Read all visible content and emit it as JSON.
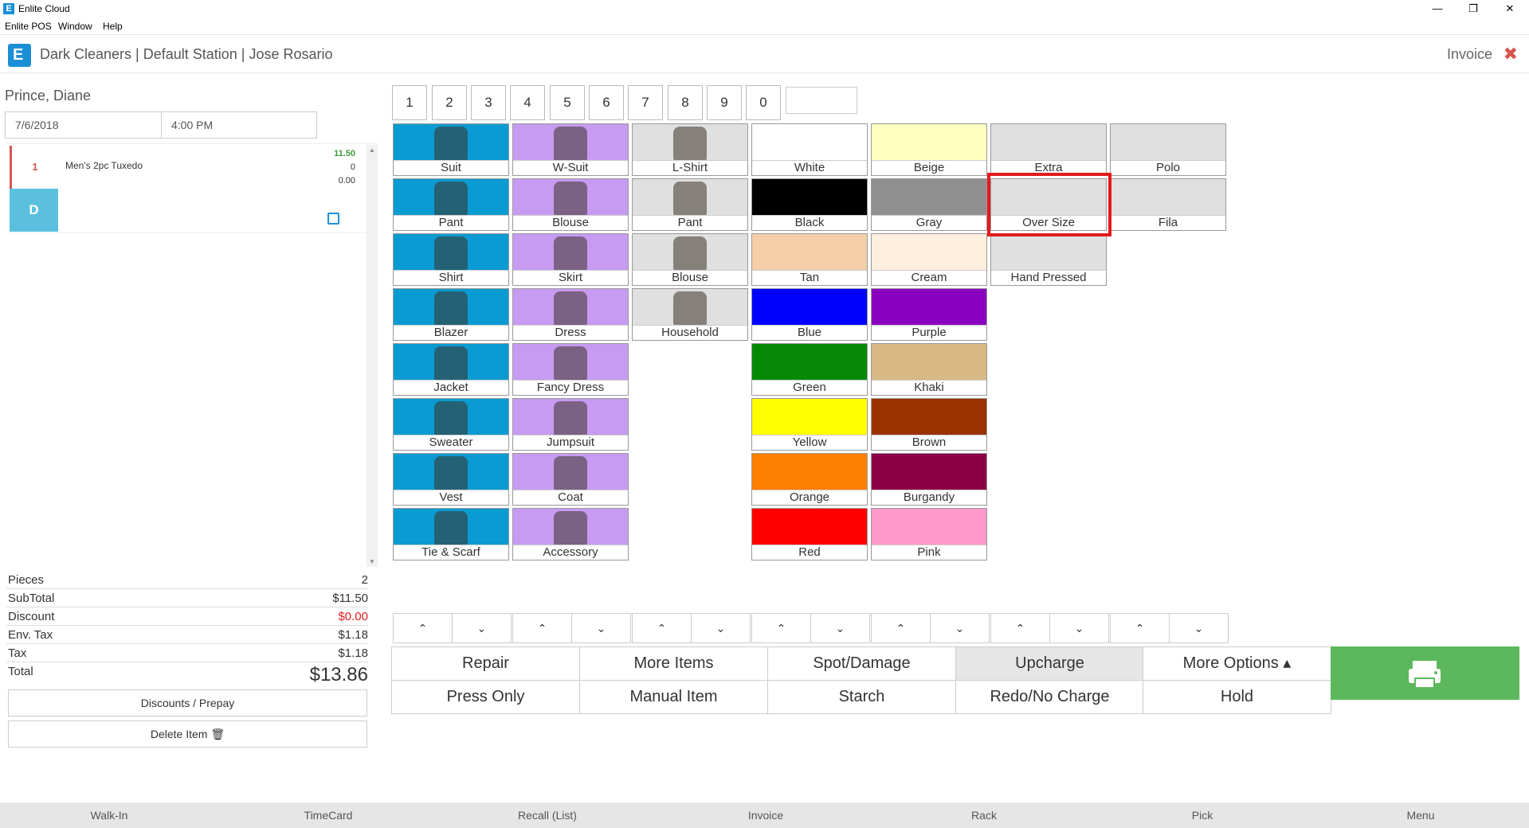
{
  "window": {
    "title": "Enlite Cloud",
    "app_icon": "E",
    "minimize": "—",
    "restore": "❐",
    "close": "✕"
  },
  "menu": [
    "Enlite POS",
    "Window",
    "Help"
  ],
  "header": {
    "store_line": "Dark Cleaners | Default Station | Jose Rosario",
    "section": "Invoice",
    "close_glyph": "✖",
    "logo_letter": "E"
  },
  "customer": {
    "name": "Prince, Diane",
    "date": "7/6/2018",
    "time": "4:00 PM"
  },
  "ticket_items": [
    {
      "qty": "1",
      "name": "Men's 2pc Tuxedo",
      "price": "11.50",
      "v2": "0",
      "v3": "0.00",
      "badge": "D"
    }
  ],
  "totals": {
    "pieces_label": "Pieces",
    "pieces": "2",
    "subtotal_label": "SubTotal",
    "subtotal": "$11.50",
    "discount_label": "Discount",
    "discount": "$0.00",
    "envtax_label": "Env. Tax",
    "envtax": "$1.18",
    "tax_label": "Tax",
    "tax": "$1.18",
    "total_label": "Total",
    "total": "$13.86"
  },
  "left_buttons": {
    "discounts": "Discounts / Prepay",
    "delete": "Delete Item 🗑"
  },
  "numpad": [
    "1",
    "2",
    "3",
    "4",
    "5",
    "6",
    "7",
    "8",
    "9",
    "0"
  ],
  "colors": {
    "male": "#0a9bd2",
    "female": "#c79bf2",
    "other": "#e0e0e0",
    "accent_green": "#5cb85c",
    "highlight": "#e21b1b"
  },
  "categories_male": [
    "Suit",
    "Pant",
    "Shirt",
    "Blazer",
    "Jacket",
    "Sweater",
    "Vest",
    "Tie & Scarf"
  ],
  "categories_female": [
    "W-Suit",
    "Blouse",
    "Skirt",
    "Dress",
    "Fancy Dress",
    "Jumpsuit",
    "Coat",
    "Accessory"
  ],
  "categories_other": [
    "L-Shirt",
    "Pant",
    "Blouse",
    "Household"
  ],
  "color_options_a": [
    {
      "name": "White",
      "hex": "#ffffff"
    },
    {
      "name": "Black",
      "hex": "#000000"
    },
    {
      "name": "Tan",
      "hex": "#f5cfa8"
    },
    {
      "name": "Blue",
      "hex": "#0000ff"
    },
    {
      "name": "Green",
      "hex": "#068a06"
    },
    {
      "name": "Yellow",
      "hex": "#ffff00"
    },
    {
      "name": "Orange",
      "hex": "#ff7f00"
    },
    {
      "name": "Red",
      "hex": "#ff0000"
    }
  ],
  "color_options_b": [
    {
      "name": "Beige",
      "hex": "#ffffc0"
    },
    {
      "name": "Gray",
      "hex": "#8f8f8f"
    },
    {
      "name": "Cream",
      "hex": "#fdeedd"
    },
    {
      "name": "Purple",
      "hex": "#8a00c0"
    },
    {
      "name": "Khaki",
      "hex": "#d8b985"
    },
    {
      "name": "Brown",
      "hex": "#9a3200"
    },
    {
      "name": "Burgandy",
      "hex": "#8b0046"
    },
    {
      "name": "Pink",
      "hex": "#ff99cc"
    }
  ],
  "upcharges_a": [
    "Extra",
    "Over Size",
    "Hand Pressed"
  ],
  "upcharges_b": [
    "Polo",
    "Fila"
  ],
  "actions_row1": [
    "Repair",
    "More Items",
    "Spot/Damage",
    "Upcharge",
    "More Options ▴"
  ],
  "actions_row2": [
    "Press Only",
    "Manual Item",
    "Starch",
    "Redo/No Charge",
    "Hold"
  ],
  "footer": [
    "Walk-In",
    "TimeCard",
    "Recall (List)",
    "Invoice",
    "Rack",
    "Pick",
    "Menu"
  ]
}
